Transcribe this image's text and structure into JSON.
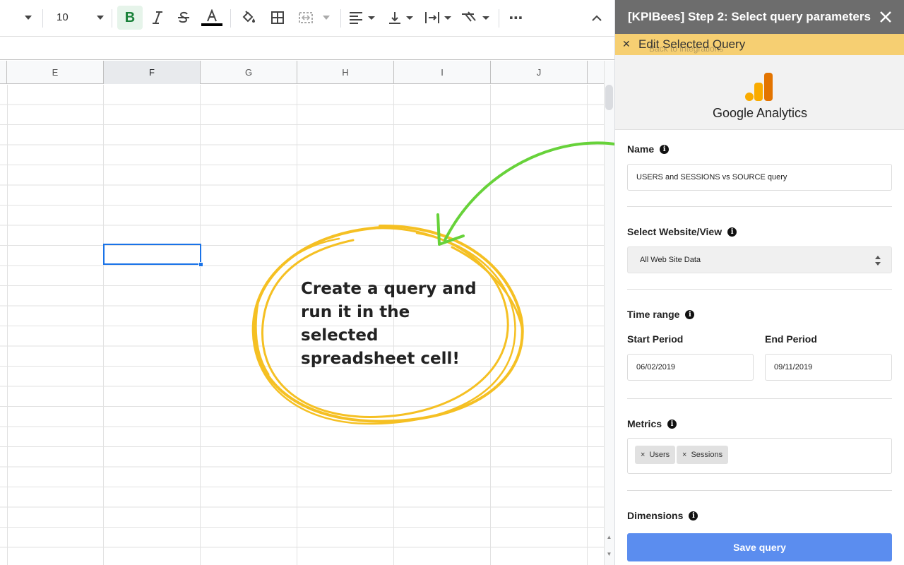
{
  "toolbar": {
    "font_size": "10",
    "bold_label": "B",
    "more_label": "⋯",
    "text_color": "#000000"
  },
  "grid": {
    "columns": [
      "E",
      "F",
      "G",
      "H",
      "I",
      "J"
    ],
    "selected_column": "F"
  },
  "callout": {
    "lines": [
      "Create a query and",
      "run it in the",
      "selected",
      "spreadsheet cell!"
    ],
    "circle_color": "#f5c023",
    "arrow_color": "#67d23a"
  },
  "panel": {
    "title": "[KPIBees] Step 2: Select query parameters",
    "edit_label": "Edit Selected Query",
    "back_link": "Back to integrations",
    "brand_name": "Google Analytics",
    "name_label": "Name",
    "name_value": "USERS and SESSIONS vs SOURCE query",
    "website_label": "Select Website/View",
    "website_value": "All Web Site Data",
    "time_range_label": "Time range",
    "start_label": "Start Period",
    "start_value": "06/02/2019",
    "end_label": "End Period",
    "end_value": "09/11/2019",
    "metrics_label": "Metrics",
    "metrics": [
      "Users",
      "Sessions"
    ],
    "dimensions_label": "Dimensions",
    "save_label": "Save query",
    "header_color": "#6d6d6d",
    "edit_bar_color": "#f6cf72",
    "save_color": "#5b8def"
  }
}
